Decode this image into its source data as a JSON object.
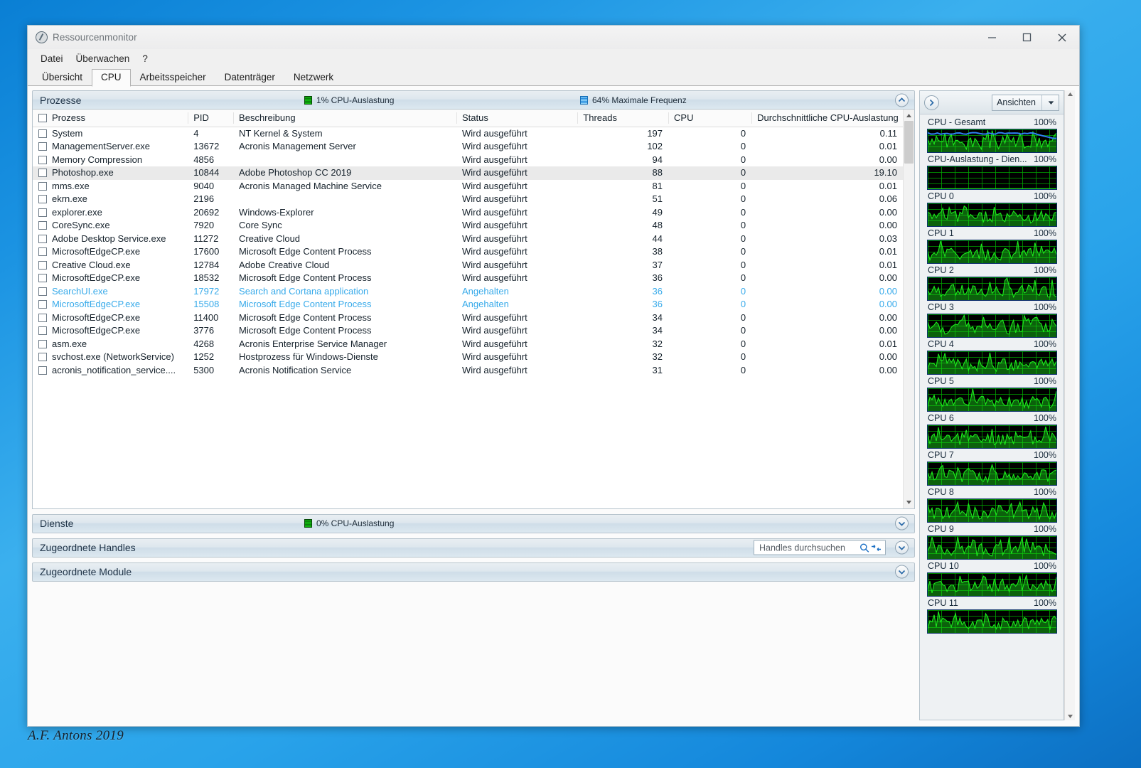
{
  "window": {
    "title": "Ressourcenmonitor",
    "icon": "resource-monitor-icon",
    "minimize_label": "—",
    "maximize_label": "□",
    "close_label": "✕"
  },
  "menu": {
    "items": [
      "Datei",
      "Überwachen",
      "?"
    ]
  },
  "tabs": {
    "items": [
      "Übersicht",
      "CPU",
      "Arbeitsspeicher",
      "Datenträger",
      "Netzwerk"
    ],
    "active": "CPU"
  },
  "sections": {
    "processes": {
      "title": "Prozesse",
      "stat_cpu": "1% CPU-Auslastung",
      "stat_freq": "64% Maximale Frequenz",
      "expanded": true
    },
    "services": {
      "title": "Dienste",
      "stat_cpu": "0% CPU-Auslastung",
      "expanded": false
    },
    "handles": {
      "title": "Zugeordnete Handles",
      "search_placeholder": "Handles durchsuchen",
      "search_value": "",
      "expanded": false
    },
    "modules": {
      "title": "Zugeordnete Module",
      "expanded": false
    }
  },
  "table": {
    "columns": [
      "Prozess",
      "PID",
      "Beschreibung",
      "Status",
      "Threads",
      "CPU",
      "Durchschnittliche CPU-Auslastung"
    ],
    "rows": [
      {
        "name": "System",
        "pid": "4",
        "desc": "NT Kernel & System",
        "status": "Wird ausgeführt",
        "threads": "197",
        "cpu": "0",
        "avg": "0.11",
        "state": "running"
      },
      {
        "name": "ManagementServer.exe",
        "pid": "13672",
        "desc": "Acronis Management Server",
        "status": "Wird ausgeführt",
        "threads": "102",
        "cpu": "0",
        "avg": "0.01",
        "state": "running"
      },
      {
        "name": "Memory Compression",
        "pid": "4856",
        "desc": "",
        "status": "Wird ausgeführt",
        "threads": "94",
        "cpu": "0",
        "avg": "0.00",
        "state": "running"
      },
      {
        "name": "Photoshop.exe",
        "pid": "10844",
        "desc": "Adobe Photoshop CC 2019",
        "status": "Wird ausgeführt",
        "threads": "88",
        "cpu": "0",
        "avg": "19.10",
        "state": "selected"
      },
      {
        "name": "mms.exe",
        "pid": "9040",
        "desc": "Acronis Managed Machine Service",
        "status": "Wird ausgeführt",
        "threads": "81",
        "cpu": "0",
        "avg": "0.01",
        "state": "running"
      },
      {
        "name": "ekrn.exe",
        "pid": "2196",
        "desc": "",
        "status": "Wird ausgeführt",
        "threads": "51",
        "cpu": "0",
        "avg": "0.06",
        "state": "running"
      },
      {
        "name": "explorer.exe",
        "pid": "20692",
        "desc": "Windows-Explorer",
        "status": "Wird ausgeführt",
        "threads": "49",
        "cpu": "0",
        "avg": "0.00",
        "state": "running"
      },
      {
        "name": "CoreSync.exe",
        "pid": "7920",
        "desc": "Core Sync",
        "status": "Wird ausgeführt",
        "threads": "48",
        "cpu": "0",
        "avg": "0.00",
        "state": "running"
      },
      {
        "name": "Adobe Desktop Service.exe",
        "pid": "11272",
        "desc": "Creative Cloud",
        "status": "Wird ausgeführt",
        "threads": "44",
        "cpu": "0",
        "avg": "0.03",
        "state": "running"
      },
      {
        "name": "MicrosoftEdgeCP.exe",
        "pid": "17600",
        "desc": "Microsoft Edge Content Process",
        "status": "Wird ausgeführt",
        "threads": "38",
        "cpu": "0",
        "avg": "0.01",
        "state": "running"
      },
      {
        "name": "Creative Cloud.exe",
        "pid": "12784",
        "desc": "Adobe Creative Cloud",
        "status": "Wird ausgeführt",
        "threads": "37",
        "cpu": "0",
        "avg": "0.01",
        "state": "running"
      },
      {
        "name": "MicrosoftEdgeCP.exe",
        "pid": "18532",
        "desc": "Microsoft Edge Content Process",
        "status": "Wird ausgeführt",
        "threads": "36",
        "cpu": "0",
        "avg": "0.00",
        "state": "running"
      },
      {
        "name": "SearchUI.exe",
        "pid": "17972",
        "desc": "Search and Cortana application",
        "status": "Angehalten",
        "threads": "36",
        "cpu": "0",
        "avg": "0.00",
        "state": "suspended"
      },
      {
        "name": "MicrosoftEdgeCP.exe",
        "pid": "15508",
        "desc": "Microsoft Edge Content Process",
        "status": "Angehalten",
        "threads": "36",
        "cpu": "0",
        "avg": "0.00",
        "state": "suspended"
      },
      {
        "name": "MicrosoftEdgeCP.exe",
        "pid": "11400",
        "desc": "Microsoft Edge Content Process",
        "status": "Wird ausgeführt",
        "threads": "34",
        "cpu": "0",
        "avg": "0.00",
        "state": "running"
      },
      {
        "name": "MicrosoftEdgeCP.exe",
        "pid": "3776",
        "desc": "Microsoft Edge Content Process",
        "status": "Wird ausgeführt",
        "threads": "34",
        "cpu": "0",
        "avg": "0.00",
        "state": "running"
      },
      {
        "name": "asm.exe",
        "pid": "4268",
        "desc": "Acronis Enterprise Service Manager",
        "status": "Wird ausgeführt",
        "threads": "32",
        "cpu": "0",
        "avg": "0.01",
        "state": "running"
      },
      {
        "name": "svchost.exe (NetworkService)",
        "pid": "1252",
        "desc": "Hostprozess für Windows-Dienste",
        "status": "Wird ausgeführt",
        "threads": "32",
        "cpu": "0",
        "avg": "0.00",
        "state": "running"
      },
      {
        "name": "acronis_notification_service....",
        "pid": "5300",
        "desc": "Acronis Notification Service",
        "status": "Wird ausgeführt",
        "threads": "31",
        "cpu": "0",
        "avg": "0.00",
        "state": "running"
      }
    ]
  },
  "sidebar": {
    "views_label": "Ansichten",
    "expand_icon": "chevron-right-icon",
    "graphs": [
      {
        "label": "CPU - Gesamt",
        "scale": "100%",
        "has_freq_line": true
      },
      {
        "label": "CPU-Auslastung - Dien...",
        "scale": "100%",
        "has_freq_line": false,
        "flat": true
      },
      {
        "label": "CPU 0",
        "scale": "100%",
        "has_freq_line": false
      },
      {
        "label": "CPU 1",
        "scale": "100%",
        "has_freq_line": false
      },
      {
        "label": "CPU 2",
        "scale": "100%",
        "has_freq_line": false
      },
      {
        "label": "CPU 3",
        "scale": "100%",
        "has_freq_line": false
      },
      {
        "label": "CPU 4",
        "scale": "100%",
        "has_freq_line": false
      },
      {
        "label": "CPU 5",
        "scale": "100%",
        "has_freq_line": false
      },
      {
        "label": "CPU 6",
        "scale": "100%",
        "has_freq_line": false
      },
      {
        "label": "CPU 7",
        "scale": "100%",
        "has_freq_line": false
      },
      {
        "label": "CPU 8",
        "scale": "100%",
        "has_freq_line": false
      },
      {
        "label": "CPU 9",
        "scale": "100%",
        "has_freq_line": false
      },
      {
        "label": "CPU 10",
        "scale": "100%",
        "has_freq_line": false
      },
      {
        "label": "CPU 11",
        "scale": "100%",
        "has_freq_line": false
      }
    ]
  },
  "watermark": {
    "text": "A.F. Antons 2019"
  },
  "colors": {
    "graph_green": "#1de81d",
    "graph_blue": "#2f7ff5",
    "suspended_text": "#37aaea",
    "desktop_blue": "#1b93e2"
  }
}
